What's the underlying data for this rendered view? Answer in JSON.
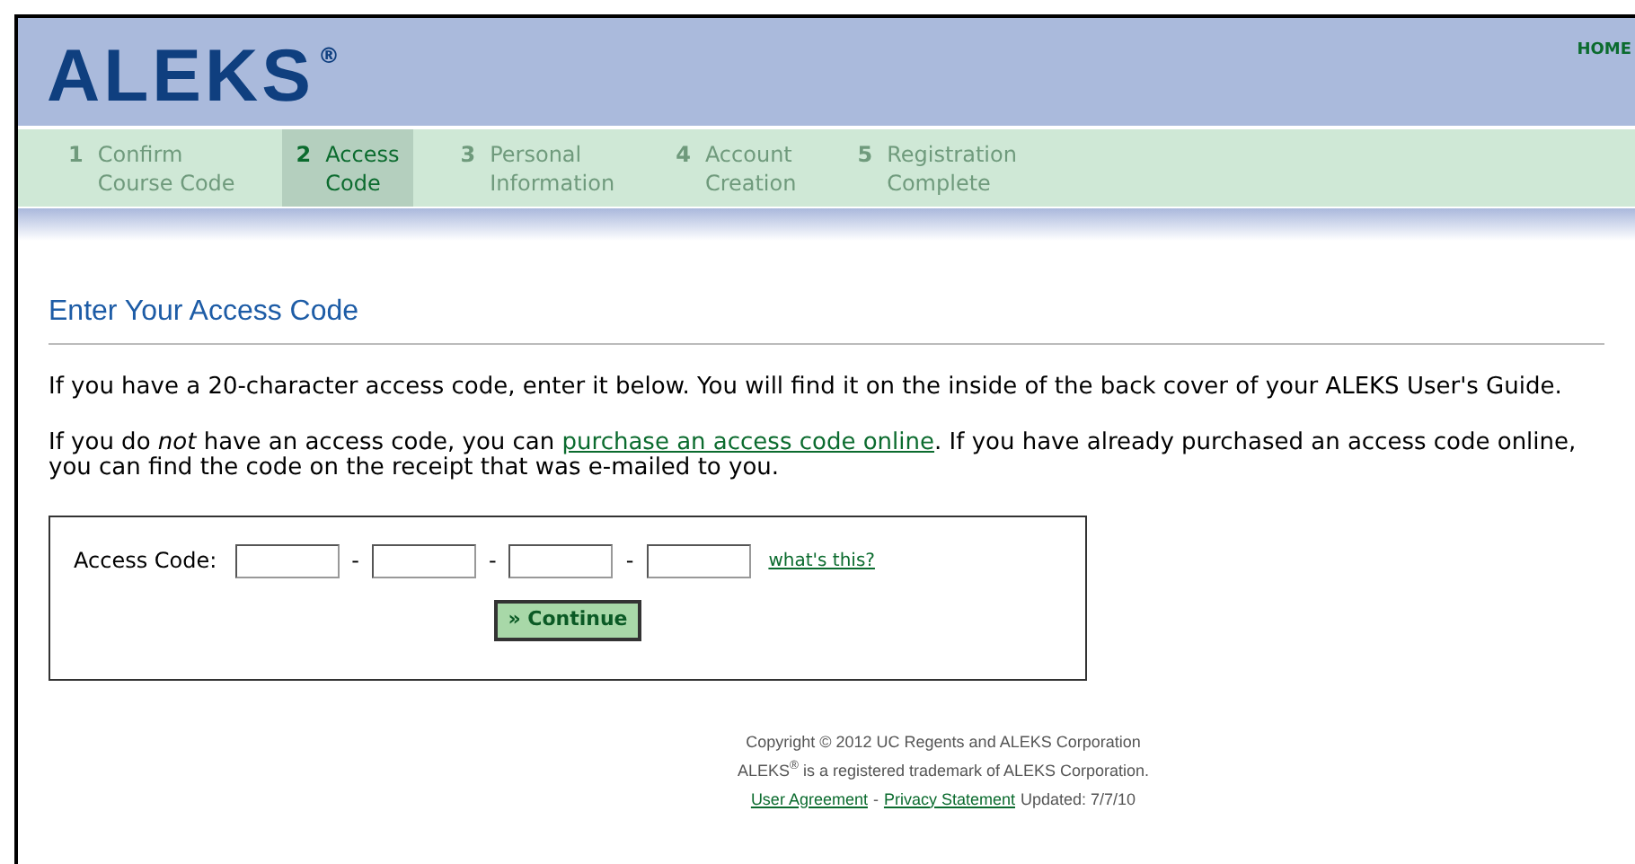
{
  "header": {
    "logo": "ALEKS",
    "logo_mark": "®",
    "nav_link": "HOME"
  },
  "steps": [
    {
      "number": "1",
      "lines": [
        "Confirm",
        "Course Code"
      ],
      "selected": false
    },
    {
      "number": "2",
      "lines": [
        "Access",
        "Code"
      ],
      "selected": true
    },
    {
      "number": "3",
      "lines": [
        "Personal",
        "Information"
      ],
      "selected": false
    },
    {
      "number": "4",
      "lines": [
        "Account",
        "Creation"
      ],
      "selected": false
    },
    {
      "number": "5",
      "lines": [
        "Registration",
        "Complete"
      ],
      "selected": false
    }
  ],
  "title": "Enter Your Access Code",
  "paragraph_1": "If you have a  20-character access code, enter it below. You will find it on the inside of the back cover of your ALEKS User's Guide.",
  "paragraph_2": {
    "before": "If you do *not* have an access code, you can",
    "link": "purchase an access code online",
    "after": ". If you have already purchased an access code online, you can find the code on the receipt that was e-mailed to you."
  },
  "form": {
    "label": "Access Code:",
    "fields": [
      {
        "kind": "text"
      },
      {
        "kind": "text"
      },
      {
        "kind": "text"
      },
      {
        "kind": "text"
      }
    ],
    "separator": "-",
    "help_link": "what's this?",
    "button": "» Continue"
  },
  "footer": {
    "copyright": "Copyright © 2012 UC Regents and ALEKS Corporation",
    "trademark": "ALEKS$^{®}$ is a registered trademark of ALEKS Corporation.",
    "links": [
      "User Agreement",
      "Privacy Statement"
    ],
    "link_separator": "-",
    "updated": "Updated: 7/7/10"
  }
}
